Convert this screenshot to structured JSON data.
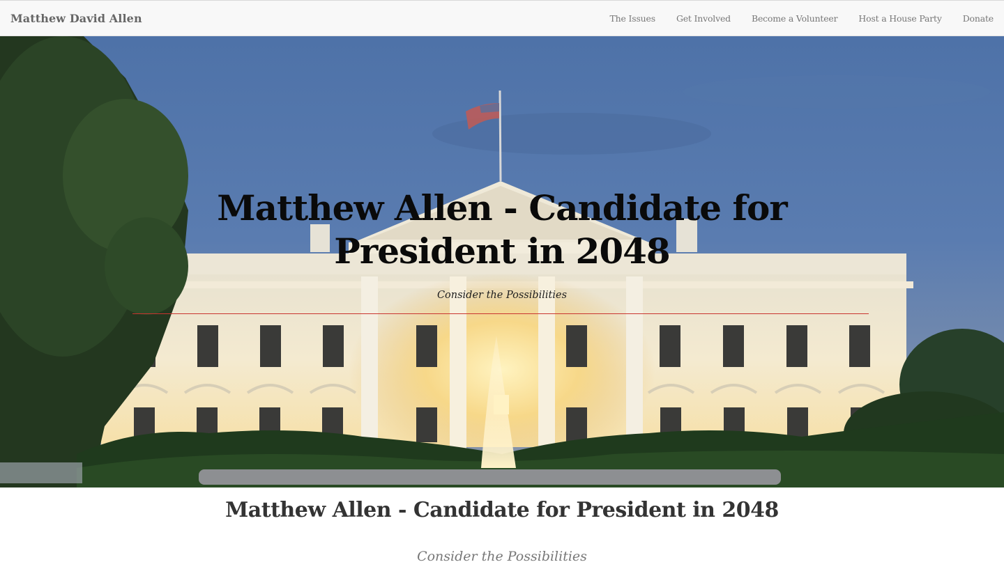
{
  "navbar": {
    "brand": "Matthew David Allen",
    "links": [
      {
        "label": "The Issues"
      },
      {
        "label": "Get Involved"
      },
      {
        "label": "Become a Volunteer"
      },
      {
        "label": "Host a House Party"
      },
      {
        "label": "Donate"
      }
    ]
  },
  "hero": {
    "title": "Matthew Allen - Candidate for President in 2048",
    "subtitle": "Consider the Possibilities",
    "rule_color": "#c9342f",
    "image": "white-house-at-dusk"
  },
  "content": {
    "title": "Matthew Allen - Candidate for President in 2048",
    "subtitle": "Consider the Possibilities"
  },
  "colors": {
    "navbar_bg": "#f8f8f8",
    "brand_text": "#666666",
    "nav_text": "#777777",
    "accent_red": "#c9342f"
  }
}
